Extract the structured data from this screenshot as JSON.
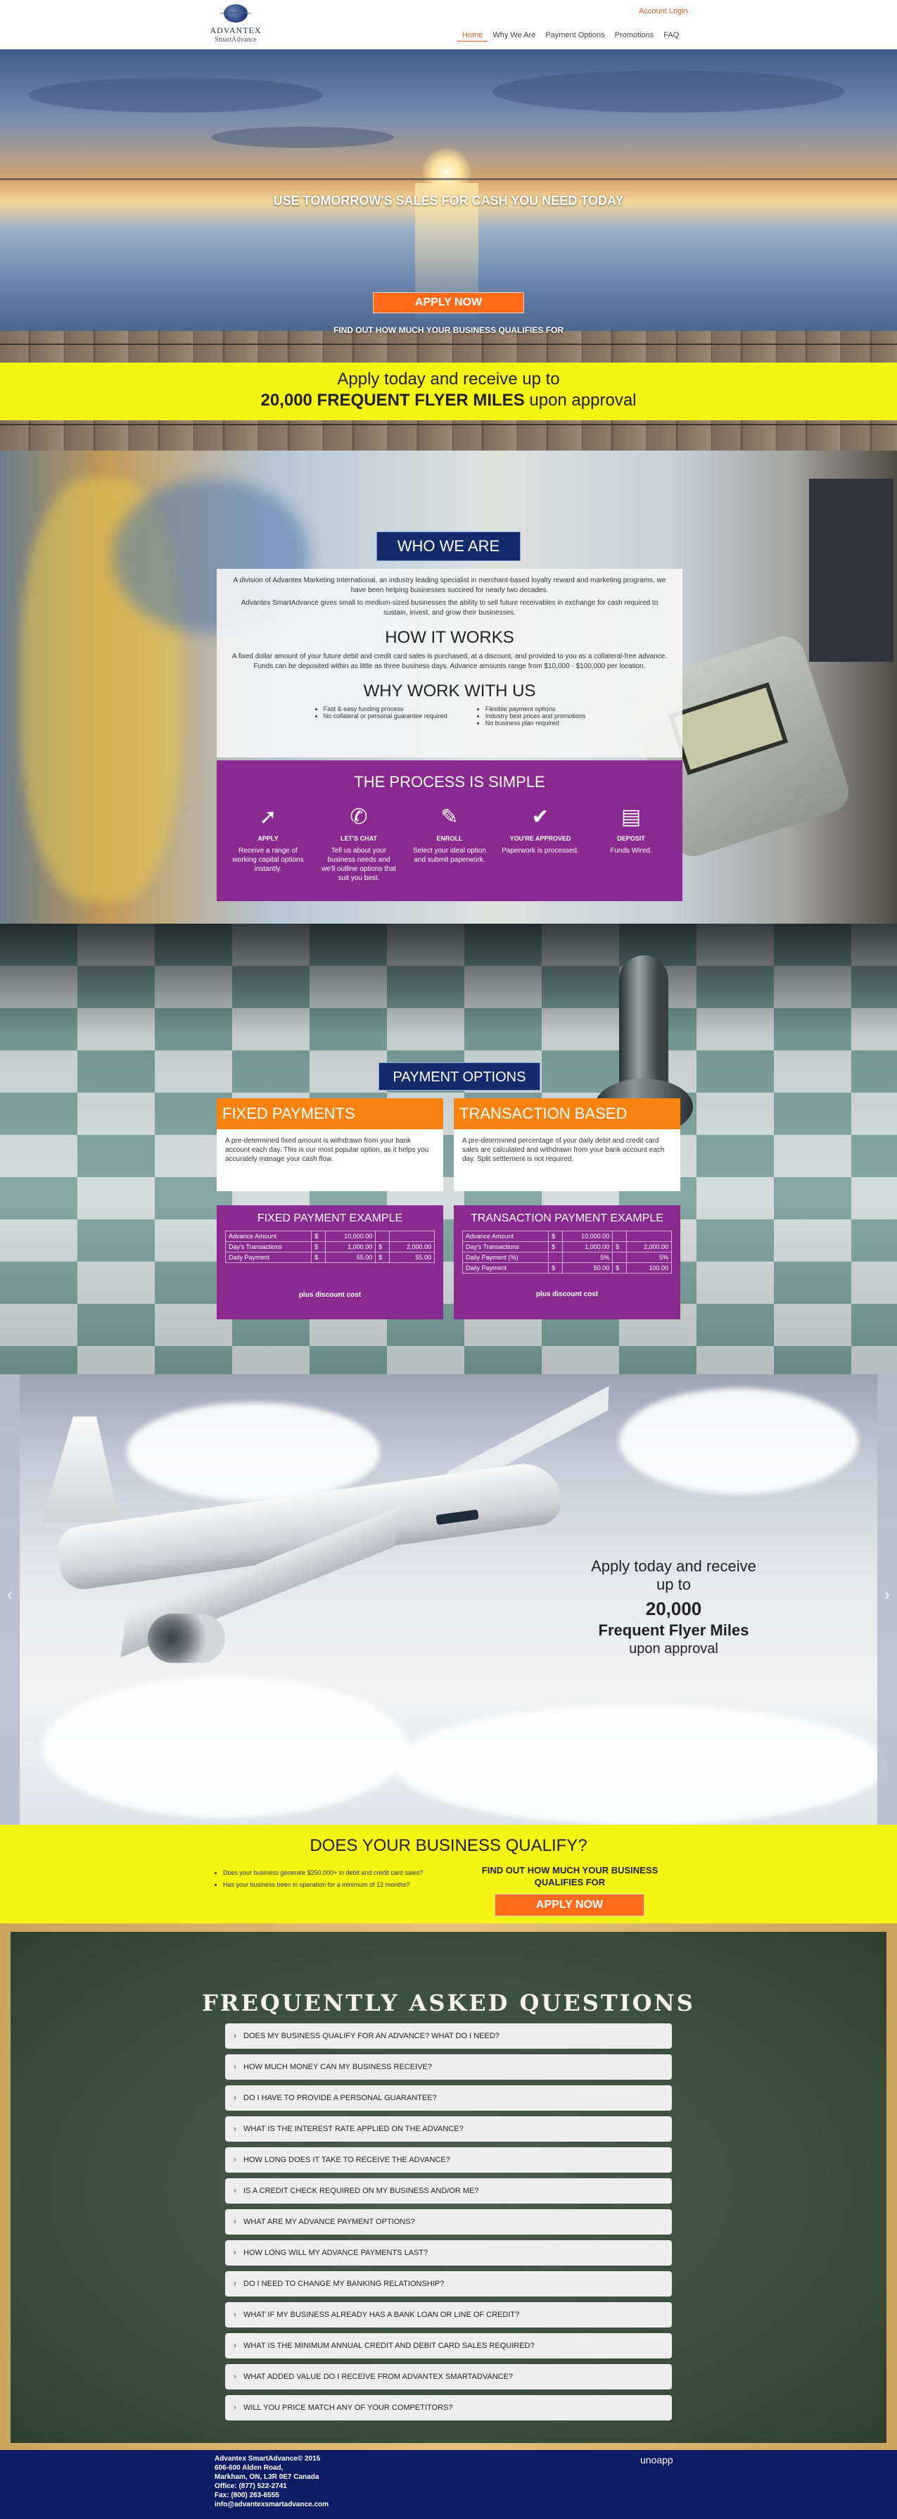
{
  "header": {
    "logo_name": "ADVANTEX",
    "logo_sub": "SmartAdvance",
    "account_login": "Account Login",
    "nav": [
      "Home",
      "Why We Are",
      "Payment Options",
      "Promotions",
      "FAQ"
    ]
  },
  "hero": {
    "title": "USE TOMORROW'S SALES FOR CASH YOU NEED TODAY",
    "apply_button": "APPLY NOW",
    "subtitle": "FIND OUT HOW MUCH YOUR BUSINESS QUALIFIES FOR",
    "band_line1": "Apply today and receive up to",
    "band_line2_bold": "20,000 FREQUENT FLYER MILES",
    "band_line2_rest": " upon approval"
  },
  "who": {
    "title": "WHO WE ARE",
    "para1": "A division of Advantex Marketing International, an industry leading specialist in merchant-based loyalty reward and marketing programs, we have been helping businesses succeed for nearly two decades.",
    "para2": "Advantex SmartAdvance gives small to medium-sized businesses the ability to sell future receivables in exchange for cash required to sustain, invest, and grow their businesses.",
    "how_title": "HOW IT WORKS",
    "how_text": "A fixed dollar amount of your future debit and credit card sales is purchased, at a discount, and provided to you as a collateral-free advance. Funds can be deposited within as little as three business days. Advance amounts range from $10,000 - $100,000 per location.",
    "why_title": "WHY WORK WITH US",
    "why_left": [
      "Fast & easy funding process",
      "No collateral or personal guarantee required"
    ],
    "why_right": [
      "Flexible payment options",
      "Industry best prices and promotions",
      "No business plan required"
    ]
  },
  "process": {
    "title": "THE PROCESS IS SIMPLE",
    "steps": [
      {
        "icon": "cursor-icon",
        "label": "APPLY",
        "desc": "Receive a range of working capital options instantly."
      },
      {
        "icon": "phone-icon",
        "label": "LET'S CHAT",
        "desc": "Tell us about your business needs and we'll outline options that suit you best."
      },
      {
        "icon": "pen-icon",
        "label": "ENROLL",
        "desc": "Select your ideal option and submit paperwork."
      },
      {
        "icon": "checkmark-icon",
        "label": "YOU'RE APPROVED",
        "desc": "Paperwork is processed."
      },
      {
        "icon": "deposit-icon",
        "label": "DEPOSIT",
        "desc": "Funds Wired."
      }
    ]
  },
  "payment": {
    "title": "PAYMENT OPTIONS",
    "fixed": {
      "head": "FIXED PAYMENTS",
      "body": "A pre-determined fixed amount is withdrawn from your bank account each day. This is our most popular option, as it helps you accurately manage your cash flow.",
      "example_title": "FIXED PAYMENT EXAMPLE",
      "rows": [
        [
          "Advance Amount",
          "$",
          "10,000.00",
          "",
          ""
        ],
        [
          "Day's Transactions",
          "$",
          "1,000.00",
          "$",
          "2,000.00"
        ],
        [
          "Daily Payment",
          "$",
          "55.00",
          "$",
          "55.00"
        ]
      ],
      "note": "plus discount cost"
    },
    "transaction": {
      "head": "TRANSACTION BASED",
      "body": "A pre-determined percentage of your daily debit and credit card sales are calculated and withdrawn from your bank account each day. Split settlement is not required.",
      "example_title": "TRANSACTION PAYMENT EXAMPLE",
      "rows": [
        [
          "Advance Amount",
          "$",
          "10,000.00",
          "",
          ""
        ],
        [
          "Day's Transactions",
          "$",
          "1,000.00",
          "$",
          "2,000.00"
        ],
        [
          "Daily Payment (%)",
          "",
          "5%",
          "",
          "5%"
        ],
        [
          "Daily Payment",
          "$",
          "50.00",
          "$",
          "100.00"
        ]
      ],
      "note": "plus discount cost"
    }
  },
  "slide": {
    "line1": "Apply today and receive up to",
    "line2": "20,000",
    "line3": "Frequent Flyer Miles",
    "line4": "upon approval",
    "prev": "‹",
    "next": "›"
  },
  "qualify": {
    "title": "DOES YOUR BUSINESS QUALIFY?",
    "items": [
      "Does your business generate $250,000+ in debit and credit card sales?",
      "Has your business been in operation for a minimum of 12 months?"
    ],
    "right_text": "FIND OUT HOW MUCH YOUR BUSINESS QUALIFIES FOR",
    "button": "APPLY NOW"
  },
  "faq": {
    "title": "FREQUENTLY ASKED QUESTIONS",
    "items": [
      "DOES MY BUSINESS QUALIFY FOR AN ADVANCE? WHAT DO I NEED?",
      "HOW MUCH MONEY CAN MY BUSINESS RECEIVE?",
      "DO I HAVE TO PROVIDE A PERSONAL GUARANTEE?",
      "WHAT IS THE INTEREST RATE APPLIED ON THE ADVANCE?",
      "HOW LONG DOES IT TAKE TO RECEIVE THE ADVANCE?",
      "IS A CREDIT CHECK REQUIRED ON MY BUSINESS AND/OR ME?",
      "WHAT ARE MY ADVANCE PAYMENT OPTIONS?",
      "HOW LONG WILL MY ADVANCE PAYMENTS LAST?",
      "DO I NEED TO CHANGE MY BANKING RELATIONSHIP?",
      "WHAT IF MY BUSINESS ALREADY HAS A BANK LOAN OR LINE OF CREDIT?",
      "WHAT IS THE MINIMUM ANNUAL CREDIT AND DEBIT CARD SALES REQUIRED?",
      "WHAT ADDED VALUE DO I RECEIVE FROM ADVANTEX SMARTADVANCE?",
      "WILL YOU PRICE MATCH ANY OF YOUR COMPETITORS?"
    ]
  },
  "footer": {
    "lines": [
      "Advantex SmartAdvance© 2015",
      "606-600 Alden Road,",
      "Markham, ON, L3R 0E7 Canada",
      "Office: (877) 522-2741",
      "Fax: (800) 263-6555",
      "info@advantexsmartadvance.com"
    ],
    "brand": "unoapp"
  }
}
